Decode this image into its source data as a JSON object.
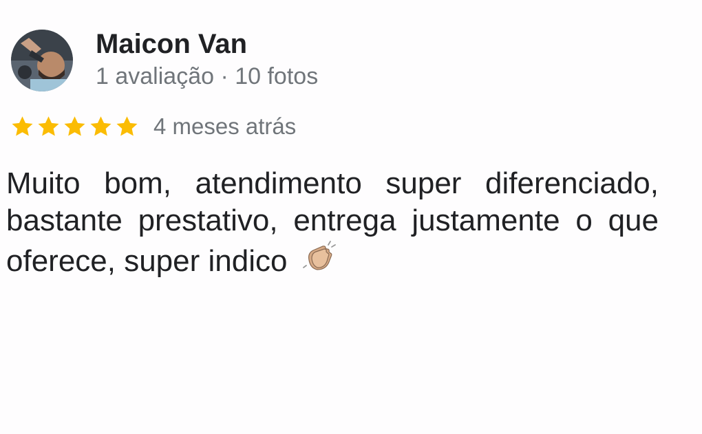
{
  "review": {
    "author": {
      "name": "Maicon Van",
      "meta": "1 avaliação · 10 fotos",
      "avatar_icon": "profile-photo"
    },
    "rating": {
      "value": 5,
      "max": 5,
      "star_color": "#fbbc04"
    },
    "time_ago": "4 meses atrás",
    "text": "Muito bom, atendimento super diferenciado, bastante prestativo, entrega justamente o que oferece, super indico",
    "emoji_icon": "clapping-hands-icon"
  }
}
